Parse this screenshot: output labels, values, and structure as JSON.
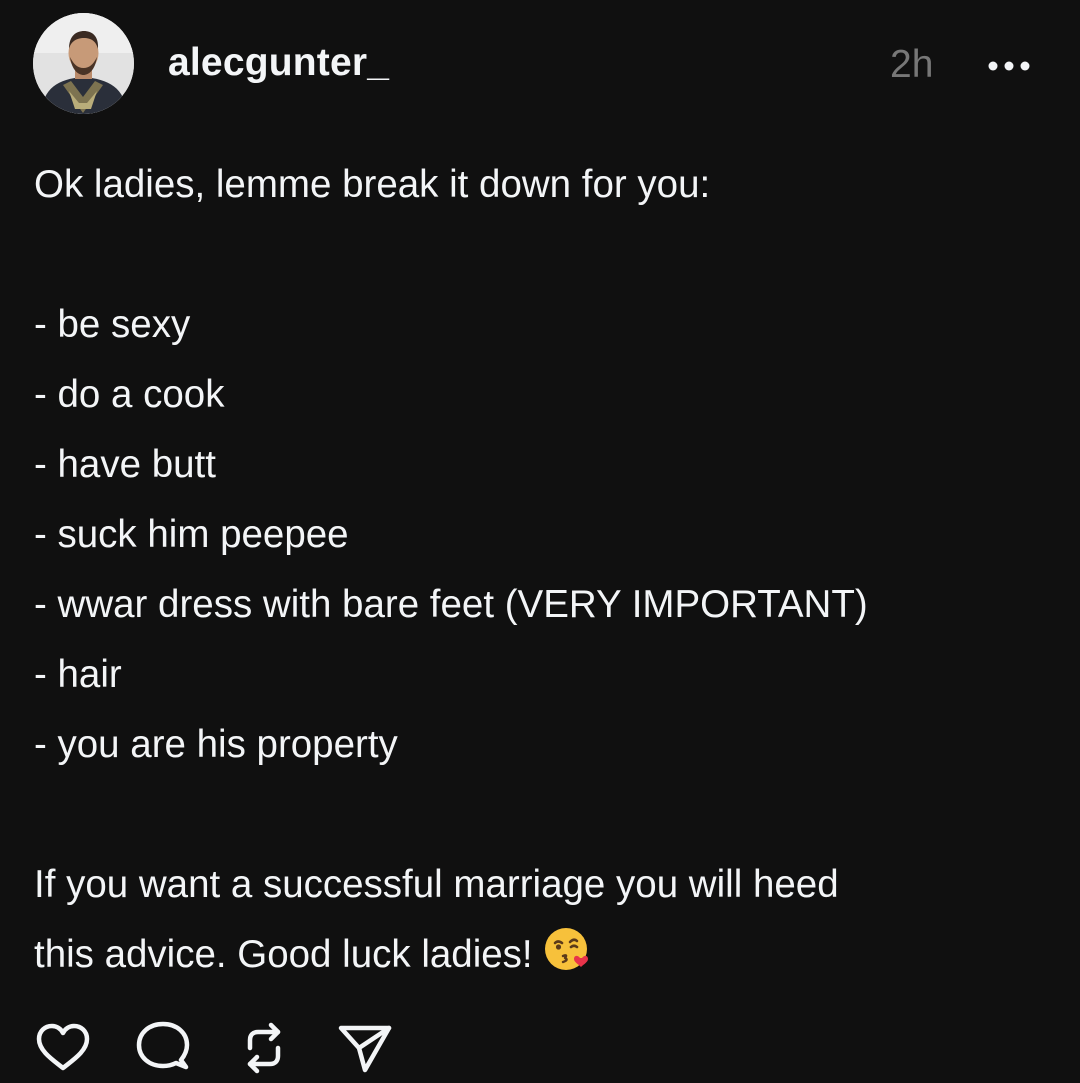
{
  "post": {
    "username": "alecgunter_",
    "timestamp": "2h",
    "intro": "Ok ladies, lemme break it down for you:",
    "list_items": [
      "- be sexy",
      "- do a cook",
      "- have butt",
      "- suck him peepee",
      "- wwar dress with bare feet (VERY IMPORTANT)",
      "- hair",
      "- you are his property"
    ],
    "closing_line_1": "If you want a successful marriage you will heed",
    "closing_line_2": "this advice. Good luck ladies!",
    "emoji": "face-blowing-a-kiss"
  },
  "icons": {
    "more": "more-horizontal-icon",
    "like": "heart-icon",
    "comment": "comment-icon",
    "repost": "repost-icon",
    "share": "send-icon"
  },
  "colors": {
    "background": "#101010",
    "text": "#f3f5f7",
    "muted": "#777777"
  }
}
